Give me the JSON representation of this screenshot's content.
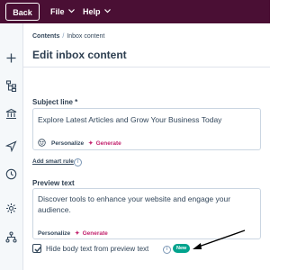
{
  "topbar": {
    "back_label": "Back",
    "menus": [
      {
        "label": "File"
      },
      {
        "label": "Help"
      }
    ]
  },
  "sidebar": {
    "icons": [
      "plus-icon",
      "flow-icon",
      "bank-icon",
      "send-icon",
      "clock-icon",
      "settings-icon",
      "hierarchy-icon"
    ]
  },
  "breadcrumb": {
    "items": [
      "Contents",
      "Inbox content"
    ]
  },
  "page_title": "Edit inbox content",
  "subject": {
    "label": "Subject line *",
    "value": "Explore Latest Articles and Grow Your Business Today",
    "personalize_label": "Personalize",
    "generate_label": "Generate"
  },
  "smart_rule_label": "Add smart rule",
  "preview": {
    "label": "Preview text",
    "value": "Discover tools to enhance your website and engage your audience.",
    "personalize_label": "Personalize",
    "generate_label": "Generate"
  },
  "hide_body": {
    "label": "Hide body text from preview text",
    "checked": true,
    "badge": "New"
  },
  "colors": {
    "topbar": "#4a0f34",
    "generate": "#c3246f",
    "badge": "#00a38d"
  }
}
